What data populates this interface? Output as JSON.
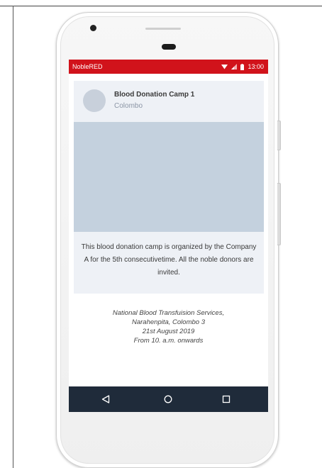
{
  "status_bar": {
    "app_name": "NobleRED",
    "time": "13:00",
    "icons": [
      "wifi-icon",
      "signal-icon",
      "battery-icon"
    ]
  },
  "camp_card": {
    "title": "Blood Donation Camp 1",
    "location": "Colombo",
    "description": "This blood donation camp is organized by the Company A for the 5th consecutivetime. All the noble donors are invited."
  },
  "details": {
    "organizer": "National Blood Transfuision Services,",
    "address": "Narahenpita, Colombo 3",
    "date": "21st August 2019",
    "time": "From 10. a.m. onwards"
  },
  "nav_bar": {
    "buttons": [
      "back-icon",
      "home-icon",
      "recents-icon"
    ]
  },
  "colors": {
    "status_bar": "#d1131b",
    "nav_bar": "#1f2b3a",
    "card_background": "#eef1f6",
    "image_placeholder": "#c4d1de"
  }
}
